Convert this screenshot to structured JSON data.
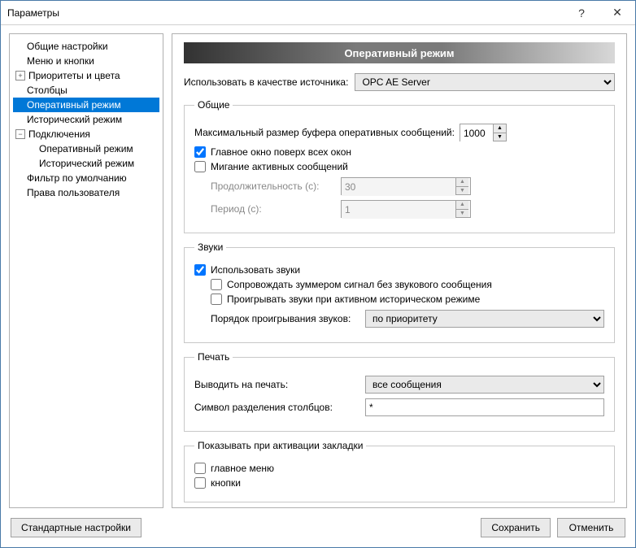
{
  "window": {
    "title": "Параметры"
  },
  "tree": {
    "items": [
      "Общие настройки",
      "Меню и кнопки",
      "Приоритеты и цвета",
      "Столбцы",
      "Оперативный режим",
      "Исторический режим",
      "Подключения",
      "Оперативный режим",
      "Исторический режим",
      "Фильтр по умолчанию",
      "Права пользователя"
    ]
  },
  "main": {
    "banner": "Оперативный режим",
    "source_label": "Использовать в качестве источника:",
    "source_value": "OPC AE Server",
    "general": {
      "legend": "Общие",
      "buffer_label": "Максимальный размер буфера оперативных сообщений:",
      "buffer_value": "1000",
      "topmost_label": "Главное окно поверх всех окон",
      "blink_label": "Мигание активных сообщений",
      "duration_label": "Продолжительность (с):",
      "duration_value": "30",
      "period_label": "Период (с):",
      "period_value": "1"
    },
    "sounds": {
      "legend": "Звуки",
      "use_sounds_label": "Использовать звуки",
      "buzzer_label": "Сопровождать зуммером сигнал без звукового сообщения",
      "play_history_label": "Проигрывать звуки при активном историческом режиме",
      "order_label": "Порядок проигрывания звуков:",
      "order_value": "по приоритету"
    },
    "print": {
      "legend": "Печать",
      "output_label": "Выводить на печать:",
      "output_value": "все сообщения",
      "delimiter_label": "Символ разделения столбцов:",
      "delimiter_value": "*"
    },
    "tabs": {
      "legend": "Показывать при активации закладки",
      "main_menu_label": "главное меню",
      "buttons_label": "кнопки"
    }
  },
  "buttons": {
    "defaults": "Стандартные настройки",
    "save": "Сохранить",
    "cancel": "Отменить"
  }
}
